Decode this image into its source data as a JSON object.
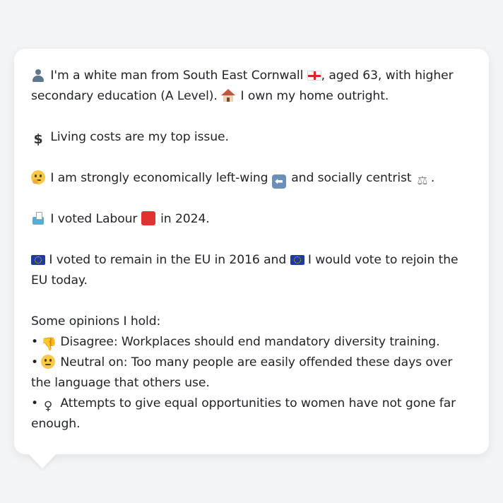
{
  "profile": {
    "intro_line": "I'm a white man from South East Cornwall",
    "intro_rest": ", aged 63, with higher secondary education (A Level).",
    "home": "I own my home outright.",
    "issue": "Living costs are my top issue.",
    "ideology_a": "I am strongly economically left-wing",
    "ideology_b": "and socially centrist",
    "ideology_end": ".",
    "vote_a": "I voted Labour",
    "vote_b": "in 2024.",
    "eu_a": "I voted to remain in the EU in 2016 and",
    "eu_b": "I would vote to rejoin the EU today."
  },
  "opinions": {
    "heading": "Some opinions I hold:",
    "items": [
      {
        "bullet": "•",
        "icon": "thumbs-down-icon",
        "label": "Disagree:",
        "text": " Workplaces should end mandatory diversity training."
      },
      {
        "bullet": "•",
        "icon": "neutral-face-icon",
        "label": "Neutral on:",
        "text": " Too many people are easily offended these days over the language that others use."
      },
      {
        "bullet": "•",
        "icon": "female-sign-icon",
        "label": "",
        "text": " Attempts to give equal opportunities to women have not gone far enough."
      }
    ]
  },
  "icons": {
    "female_glyph": "♀",
    "thumbs_glyph": "👎",
    "dollar_glyph": "$",
    "left_arrow_glyph": "⬅",
    "scales_glyph": "⚖"
  },
  "colors": {
    "bubble_bg": "#ffffff",
    "page_bg": "#f3f4f6",
    "text": "#1f2328",
    "labour_red": "#e0322e",
    "eu_blue": "#1f3c9c"
  }
}
